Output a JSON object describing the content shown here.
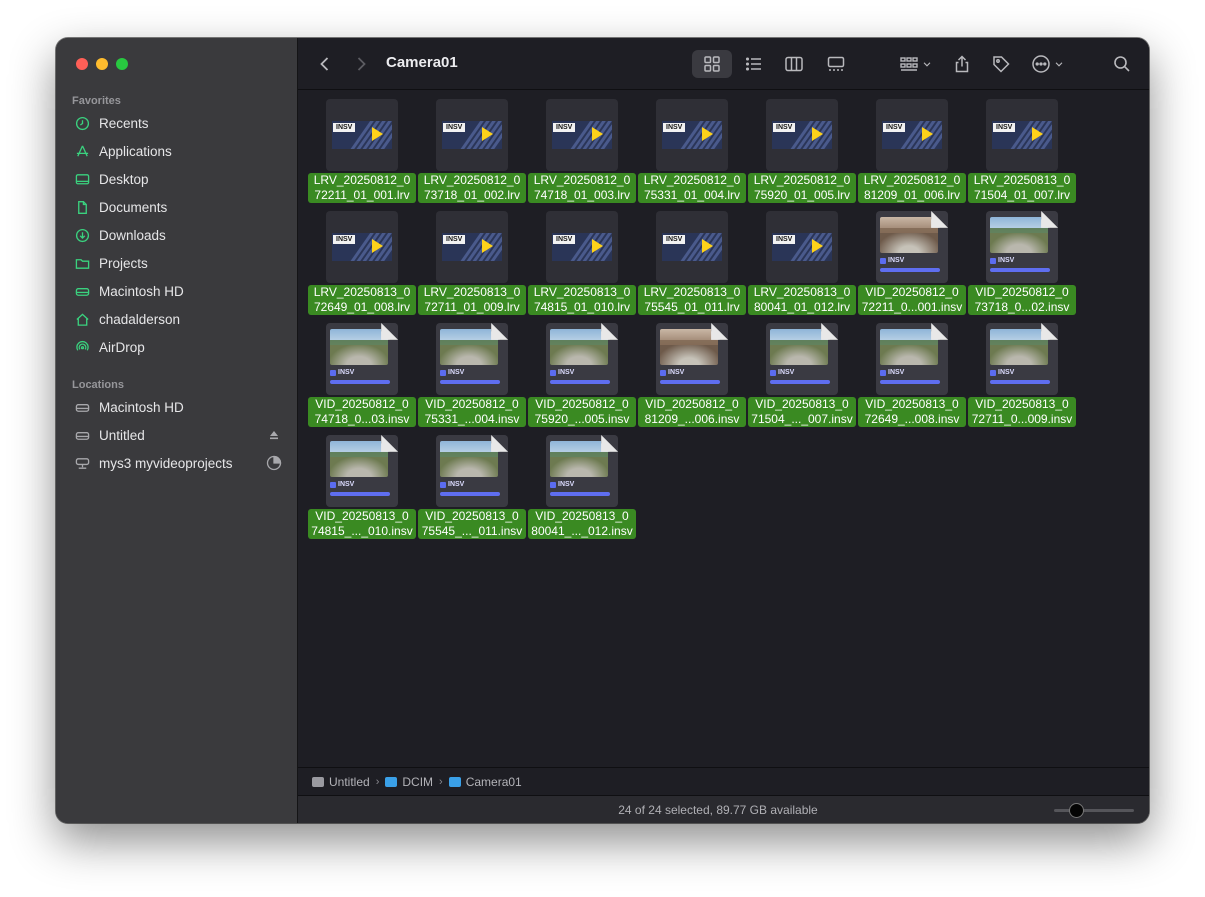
{
  "window": {
    "title": "Camera01"
  },
  "sidebar": {
    "favorites_title": "Favorites",
    "favorites": [
      {
        "label": "Recents",
        "icon": "clock-icon"
      },
      {
        "label": "Applications",
        "icon": "applications-icon"
      },
      {
        "label": "Desktop",
        "icon": "desktop-icon"
      },
      {
        "label": "Documents",
        "icon": "document-icon"
      },
      {
        "label": "Downloads",
        "icon": "download-icon"
      },
      {
        "label": "Projects",
        "icon": "folder-icon"
      },
      {
        "label": "Macintosh HD",
        "icon": "drive-icon"
      },
      {
        "label": "chadalderson",
        "icon": "home-icon"
      },
      {
        "label": "AirDrop",
        "icon": "airdrop-icon"
      }
    ],
    "locations_title": "Locations",
    "locations": [
      {
        "label": "Macintosh HD",
        "icon": "drive-icon"
      },
      {
        "label": "Untitled",
        "icon": "drive-icon",
        "trailing": "eject-icon"
      },
      {
        "label": "mys3 myvideoprojects",
        "icon": "network-drive-icon",
        "trailing": "progress-pie-icon"
      }
    ]
  },
  "toolbar": {
    "back": "chevron-left-icon",
    "forward": "chevron-right-icon",
    "views": [
      "icon-view",
      "list-view",
      "column-view",
      "gallery-view"
    ],
    "active_view": "icon-view"
  },
  "files": [
    {
      "line1": "LRV_20250812_0",
      "line2": "72211_01_001.lrv",
      "kind": "lrv"
    },
    {
      "line1": "LRV_20250812_0",
      "line2": "73718_01_002.lrv",
      "kind": "lrv"
    },
    {
      "line1": "LRV_20250812_0",
      "line2": "74718_01_003.lrv",
      "kind": "lrv"
    },
    {
      "line1": "LRV_20250812_0",
      "line2": "75331_01_004.lrv",
      "kind": "lrv"
    },
    {
      "line1": "LRV_20250812_0",
      "line2": "75920_01_005.lrv",
      "kind": "lrv"
    },
    {
      "line1": "LRV_20250812_0",
      "line2": "81209_01_006.lrv",
      "kind": "lrv"
    },
    {
      "line1": "LRV_20250813_0",
      "line2": "71504_01_007.lrv",
      "kind": "lrv"
    },
    {
      "line1": "LRV_20250813_0",
      "line2": "72649_01_008.lrv",
      "kind": "lrv"
    },
    {
      "line1": "LRV_20250813_0",
      "line2": "72711_01_009.lrv",
      "kind": "lrv"
    },
    {
      "line1": "LRV_20250813_0",
      "line2": "74815_01_010.lrv",
      "kind": "lrv"
    },
    {
      "line1": "LRV_20250813_0",
      "line2": "75545_01_011.lrv",
      "kind": "lrv"
    },
    {
      "line1": "LRV_20250813_0",
      "line2": "80041_01_012.lrv",
      "kind": "lrv"
    },
    {
      "line1": "VID_20250812_0",
      "line2": "72211_0...001.insv",
      "kind": "vid-indoor"
    },
    {
      "line1": "VID_20250812_0",
      "line2": "73718_0...02.insv",
      "kind": "vid"
    },
    {
      "line1": "VID_20250812_0",
      "line2": "74718_0...03.insv",
      "kind": "vid"
    },
    {
      "line1": "VID_20250812_0",
      "line2": "75331_...004.insv",
      "kind": "vid"
    },
    {
      "line1": "VID_20250812_0",
      "line2": "75920_...005.insv",
      "kind": "vid"
    },
    {
      "line1": "VID_20250812_0",
      "line2": "81209_...006.insv",
      "kind": "vid-indoor"
    },
    {
      "line1": "VID_20250813_0",
      "line2": "71504_..._007.insv",
      "kind": "vid"
    },
    {
      "line1": "VID_20250813_0",
      "line2": "72649_...008.insv",
      "kind": "vid"
    },
    {
      "line1": "VID_20250813_0",
      "line2": "72711_0...009.insv",
      "kind": "vid"
    },
    {
      "line1": "VID_20250813_0",
      "line2": "74815_..._010.insv",
      "kind": "vid"
    },
    {
      "line1": "VID_20250813_0",
      "line2": "75545_..._011.insv",
      "kind": "vid"
    },
    {
      "line1": "VID_20250813_0",
      "line2": "80041_..._012.insv",
      "kind": "vid"
    }
  ],
  "thumb_tags": {
    "lrv": "INSV",
    "vid": "INSV"
  },
  "pathbar": [
    "Untitled",
    "DCIM",
    "Camera01"
  ],
  "status": {
    "text": "24 of 24 selected, 89.77 GB available",
    "icon_size_slider": 0.25
  },
  "colors": {
    "selection": "#3a8a22",
    "sidebar_icon": "#3ad27f",
    "accent_bar": "#5f6ef0"
  }
}
